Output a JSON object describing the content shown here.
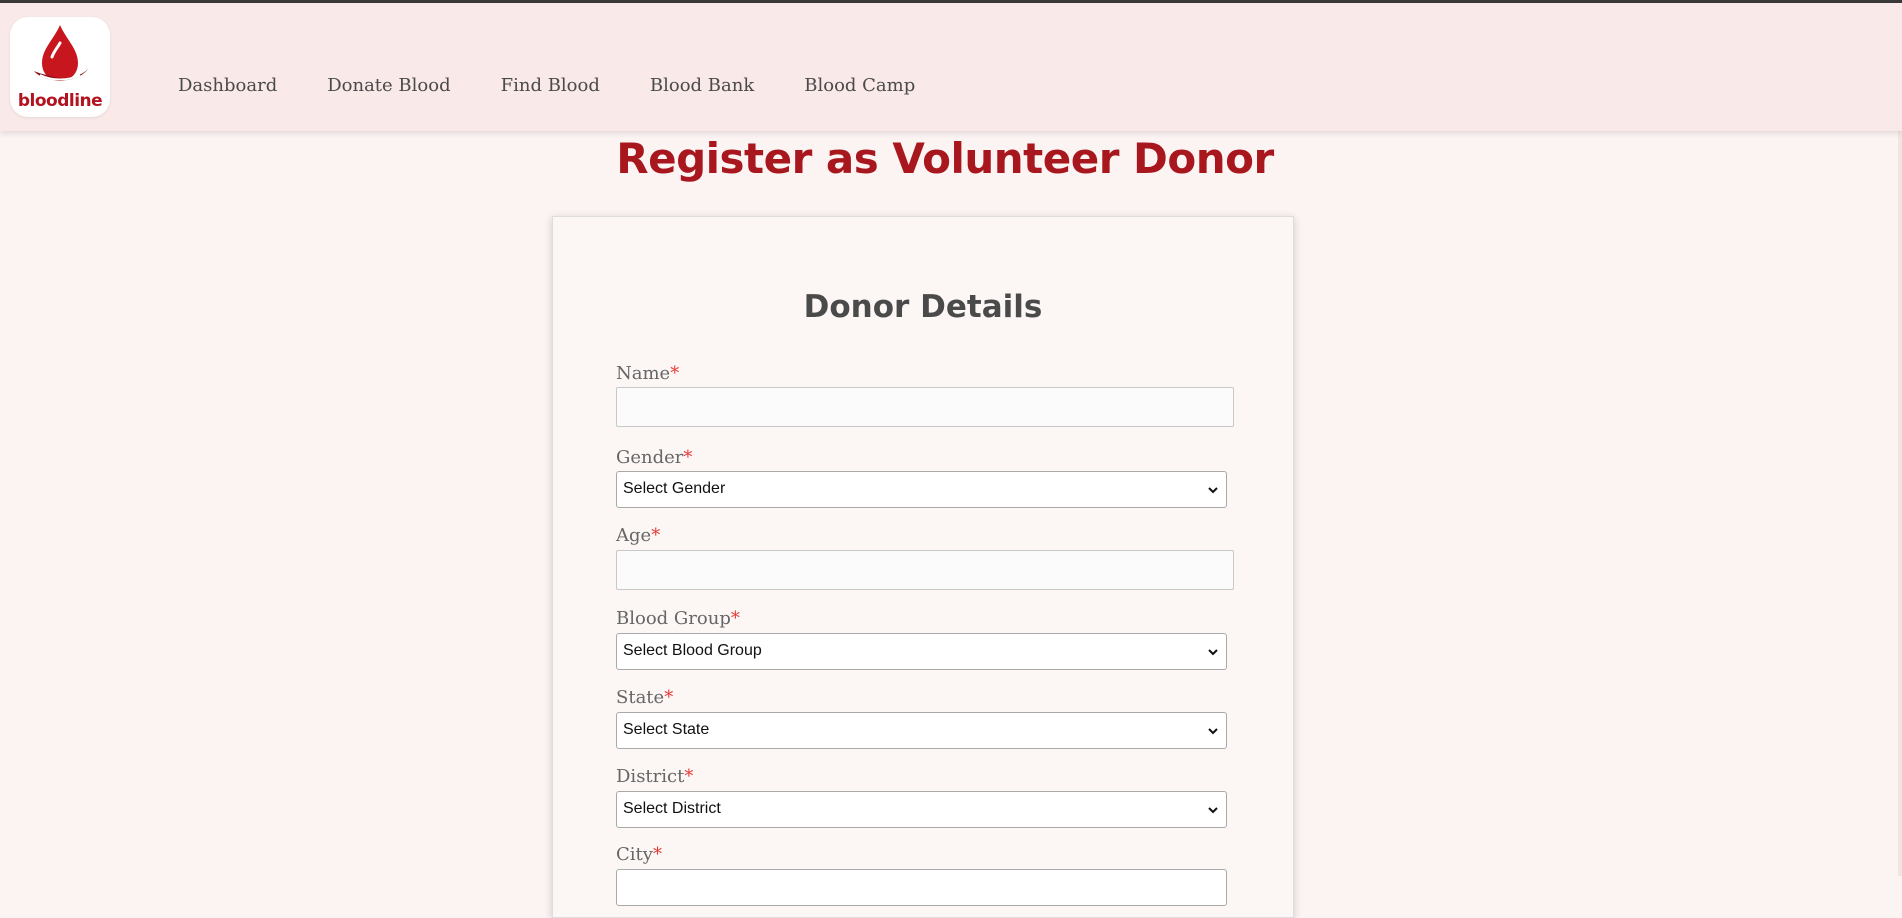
{
  "brand": {
    "logo_text": "bloodline",
    "colors": {
      "primary": "#a8171e",
      "nav_bg": "#f9e9e8",
      "page_bg": "#fcf4f3"
    }
  },
  "nav": {
    "items": [
      "Dashboard",
      "Donate Blood",
      "Find Blood",
      "Blood Bank",
      "Blood Camp"
    ]
  },
  "page": {
    "title": "Register as Volunteer Donor"
  },
  "form": {
    "title": "Donor Details",
    "required_marker": "*",
    "fields": {
      "name": {
        "label": "Name",
        "value": ""
      },
      "gender": {
        "label": "Gender",
        "selected": "Select Gender"
      },
      "age": {
        "label": "Age",
        "value": ""
      },
      "blood_group": {
        "label": "Blood Group",
        "selected": "Select Blood Group"
      },
      "state": {
        "label": "State",
        "selected": "Select State"
      },
      "district": {
        "label": "District",
        "selected": "Select District"
      },
      "city": {
        "label": "City"
      }
    }
  },
  "icons": {
    "logo": "blood-drop-hand-icon",
    "select_arrow": "chevron-down-icon"
  }
}
